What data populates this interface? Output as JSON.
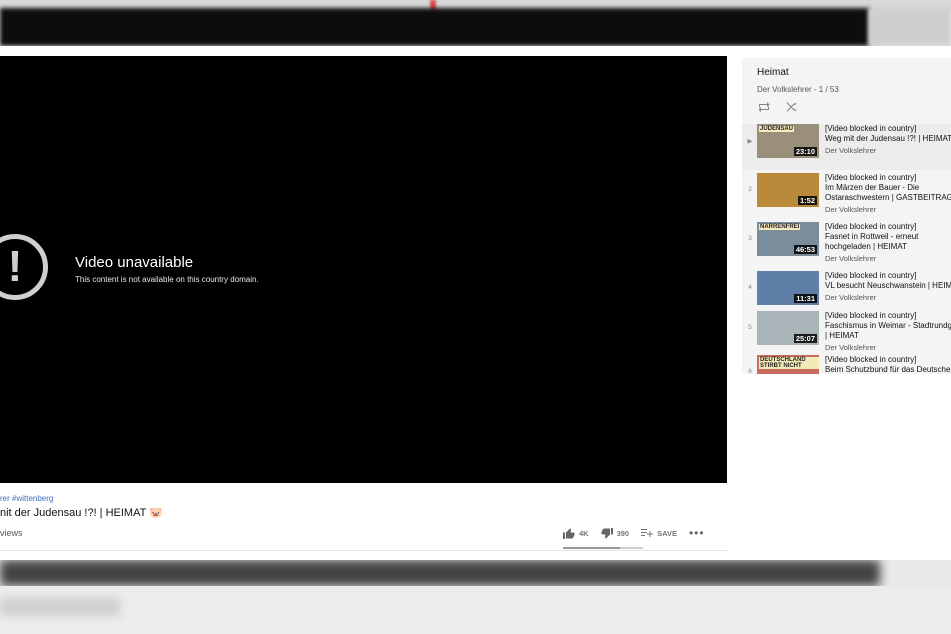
{
  "player": {
    "error_title": "Video unavailable",
    "error_message": "This content is not available on this country domain."
  },
  "video": {
    "hashtags": "rer #wittenberg",
    "title": "nit der Judensau !?! | HEIMAT 🐷",
    "views": "views"
  },
  "actions": {
    "like_count": "4K",
    "dislike_count": "390",
    "save_label": "SAVE",
    "more_label": "•••"
  },
  "playlist": {
    "title": "Heimat",
    "channel": "Der Volkslehrer",
    "position": " - 1 / 53",
    "items": [
      {
        "index": "▶",
        "duration": "23:10",
        "thumb_text": "JUDENSAU",
        "line1": "[Video blocked in country]",
        "line2": "Weg mit der Judensau !?! | HEIMAT",
        "line3": "",
        "channel": "Der Volkslehrer",
        "thumb_color": "#9a8f7a"
      },
      {
        "index": "2",
        "duration": "1:52",
        "thumb_text": "",
        "line1": "[Video blocked in country]",
        "line2": "Im Märzen der Bauer - Die",
        "line3": "Ostaraschwestern | GASTBEITRAG",
        "channel": "Der Volkslehrer",
        "thumb_color": "#b98a3a"
      },
      {
        "index": "3",
        "duration": "46:53",
        "thumb_text": "NARRENFREI",
        "line1": "[Video blocked in country]",
        "line2": "Fasnet in Rottweil - erneut",
        "line3": "hochgeladen | HEIMAT",
        "channel": "Der Volkslehrer",
        "thumb_color": "#7b8d9a"
      },
      {
        "index": "4",
        "duration": "11:31",
        "thumb_text": "",
        "line1": "[Video blocked in country]",
        "line2": "VL besucht Neuschwanstein | HEIMAT",
        "line3": "",
        "channel": "Der Volkslehrer",
        "thumb_color": "#5f7fa8"
      },
      {
        "index": "5",
        "duration": "25:07",
        "thumb_text": "",
        "line1": "[Video blocked in country]",
        "line2": "Faschismus in Weimar - Stadtrundgang",
        "line3": "| HEIMAT",
        "channel": "Der Volkslehrer",
        "thumb_color": "#a9b4b8"
      },
      {
        "index": "6",
        "duration": "",
        "thumb_text": "DEUTSCHLAND STIRBT NICHT",
        "line1": "[Video blocked in country]",
        "line2": "Beim Schutzbund für das Deutsche Volk",
        "line3": "",
        "channel": "",
        "thumb_color": "#c96b5d"
      }
    ]
  }
}
